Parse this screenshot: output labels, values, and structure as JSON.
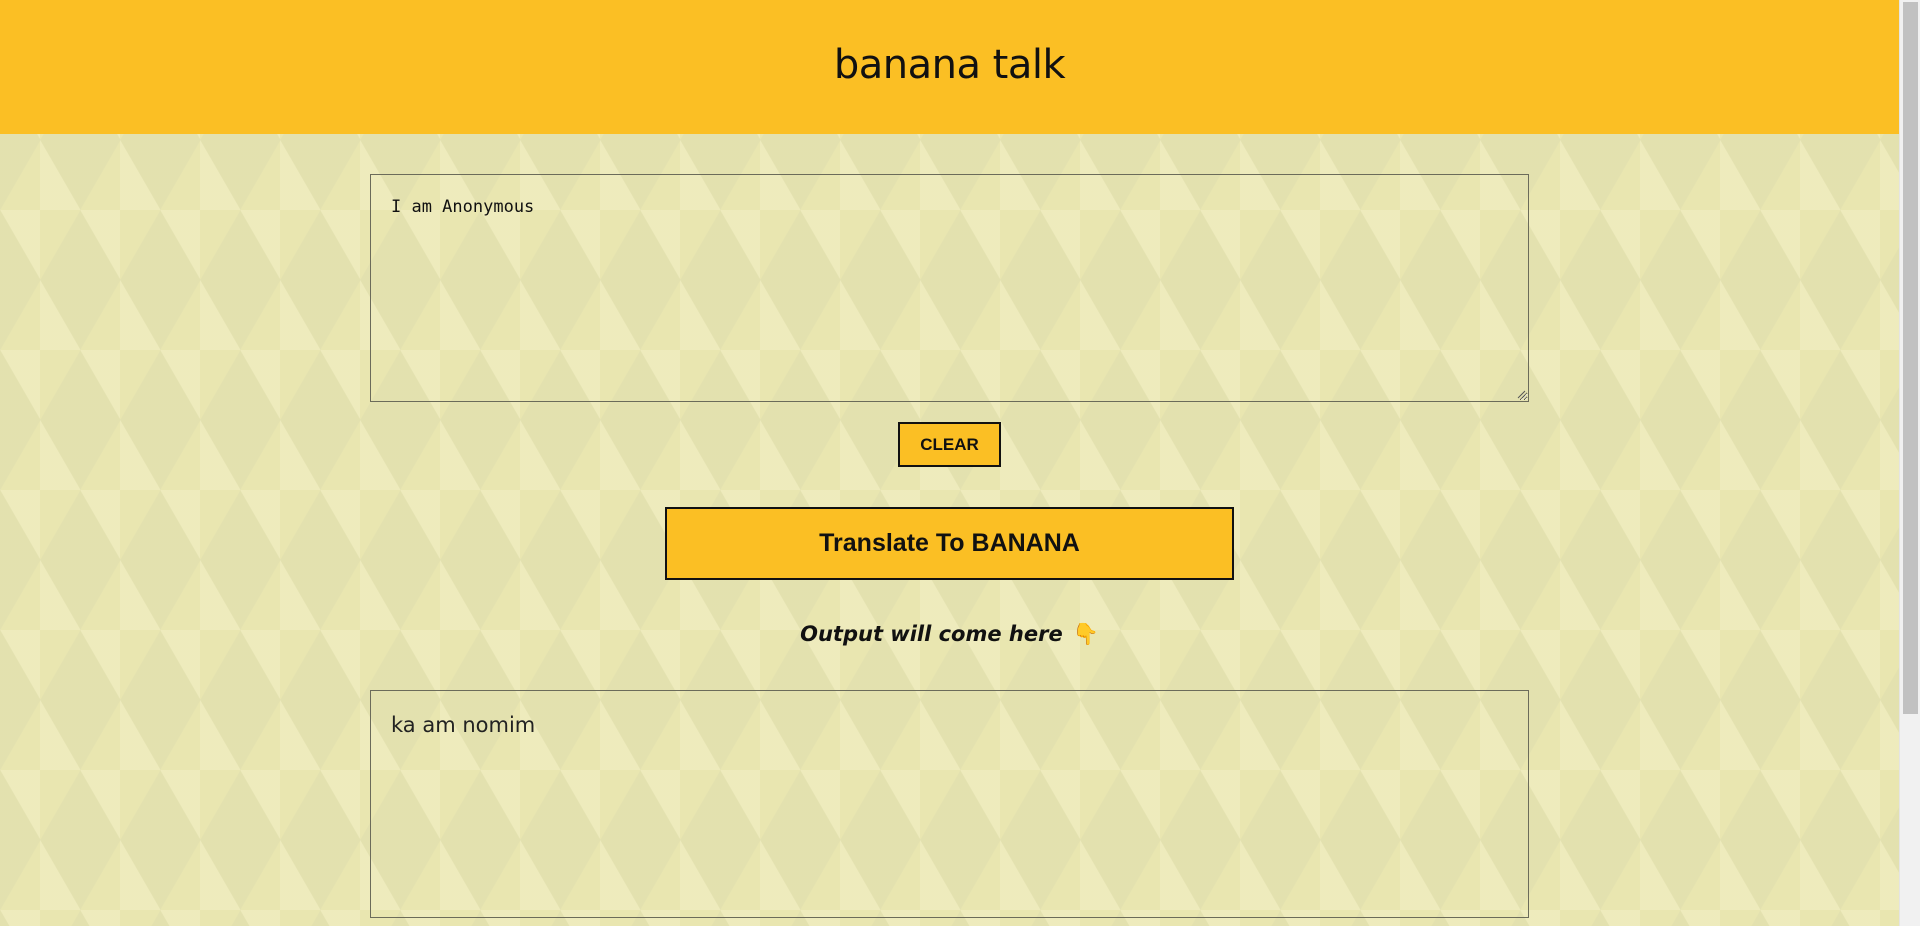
{
  "header": {
    "title": "banana talk"
  },
  "input": {
    "value": "I am Anonymous",
    "placeholder": ""
  },
  "buttons": {
    "clear_label": "CLEAR",
    "translate_label": "Translate To BANANA"
  },
  "output": {
    "label": "Output will come here",
    "label_icon": "👇",
    "text": "ka am nomim"
  },
  "colors": {
    "accent": "#fbbf24",
    "background": "#e9e6b0",
    "text": "#111111"
  },
  "icons": {
    "output_pointer": "pointing-down-hand-icon",
    "textarea_resize": "resize-grip-icon"
  }
}
